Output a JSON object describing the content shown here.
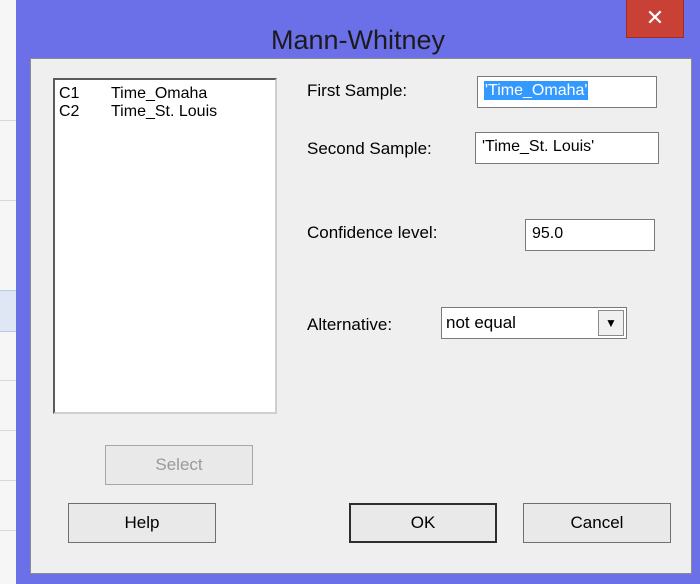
{
  "dialog": {
    "title": "Mann-Whitney",
    "close_glyph": "✕"
  },
  "columns": [
    {
      "id": "C1",
      "name": "Time_Omaha"
    },
    {
      "id": "C2",
      "name": "Time_St. Louis"
    }
  ],
  "fields": {
    "first_sample_label": "First Sample:",
    "first_sample_value": "'Time_Omaha'",
    "second_sample_label": "Second Sample:",
    "second_sample_value": "'Time_St. Louis'",
    "confidence_label": "Confidence level:",
    "confidence_value": "95.0",
    "alternative_label": "Alternative:",
    "alternative_value": "not equal",
    "dropdown_glyph": "▼"
  },
  "buttons": {
    "select": "Select",
    "help": "Help",
    "ok": "OK",
    "cancel": "Cancel"
  },
  "colors": {
    "titlebar": "#6b6fe8",
    "close": "#c94036",
    "selection": "#3399ff"
  }
}
